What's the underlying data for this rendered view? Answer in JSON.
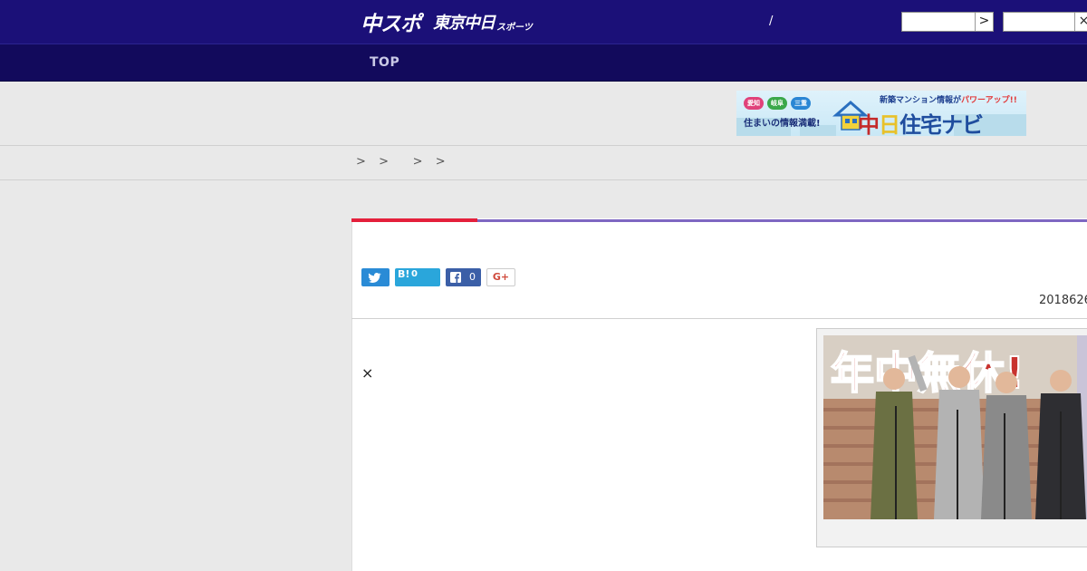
{
  "header": {
    "logo_main": "中スポ",
    "logo_sub": "東京中日",
    "logo_small": "スポーツ",
    "slash": "/",
    "button_arrow": ">",
    "button_close": "×"
  },
  "nav": {
    "items": [
      {
        "label": "TOP"
      }
    ]
  },
  "banner": {
    "headline": "新築マンション情報が",
    "headline_accent": "パワーアップ!!",
    "regions": [
      "愛知",
      "岐阜",
      "三重"
    ],
    "region_colors": [
      "#e0427a",
      "#3aa84a",
      "#2a86d4"
    ],
    "tagline": "住まいの情報満載!",
    "brand_part1": "中",
    "brand_part2": "日",
    "brand_part3": "住宅ナビ"
  },
  "breadcrumb": {
    "text": ">  >    >  >"
  },
  "article": {
    "share": {
      "hatena_label": "B!",
      "hatena_count": "0",
      "facebook_count": "0",
      "gplus_label": "G+"
    },
    "date": "2018626",
    "close_symbol": "×",
    "photo_sign_text": "年中無休!"
  },
  "colors": {
    "header_bg": "#1b1078",
    "nav_bg": "#120a5c",
    "accent_red": "#e4203b",
    "accent_purple": "#7e67c2",
    "twitter": "#2a8bd6",
    "hatena": "#2aa6db",
    "facebook": "#3b5fa7"
  }
}
